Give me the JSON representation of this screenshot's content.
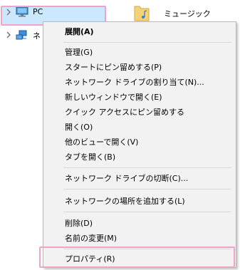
{
  "tree": {
    "pc_label": "PC",
    "network_label": "ネ"
  },
  "content": {
    "music_label": "ミュージック"
  },
  "menu": {
    "items": [
      "展開(A)",
      "管理(G)",
      "スタートにピン留めする(P)",
      "ネットワーク ドライブの割り当て(N)...",
      "新しいウィンドウで開く(E)",
      "クイック アクセスにピン留めする",
      "開く(O)",
      "他のビューで開く(V)",
      "タブを開く(B)",
      "ネットワーク ドライブの切断(C)...",
      "ネットワークの場所を追加する(L)",
      "削除(D)",
      "名前の変更(M)",
      "プロパティ(R)"
    ]
  },
  "colors": {
    "highlight_border": "#f0a3c6",
    "selection": "#cce8ff",
    "menu_background": "#f2f2f2"
  }
}
